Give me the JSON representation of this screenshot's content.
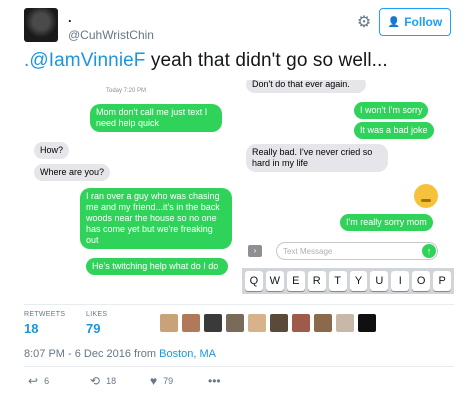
{
  "user": {
    "display_name": ".",
    "handle": "@CuhWristChin",
    "avatar": "profile-photo"
  },
  "header": {
    "settings_icon": "gear-icon",
    "follow_label": "Follow",
    "follow_icon": "add-user-icon"
  },
  "tweet": {
    "mention": ".@IamVinnieF",
    "text": " yeah that didn't go so well..."
  },
  "media": {
    "left": {
      "timestamp": "Today 7:20 PM",
      "messages": [
        {
          "from": "me",
          "text": "Mom don't call me just text I need help quick"
        },
        {
          "from": "them",
          "text": "How?"
        },
        {
          "from": "them",
          "text": "Where are you?"
        },
        {
          "from": "me",
          "text": "I ran over a guy who was chasing me and my friend...it's in the back woods near the house so no one has come yet but we're freaking out"
        },
        {
          "from": "me",
          "text": "He's twitching help what do I do"
        }
      ]
    },
    "right": {
      "messages": [
        {
          "from": "them",
          "text": "Don't do that ever again."
        },
        {
          "from": "me",
          "text": "I won't I'm sorry"
        },
        {
          "from": "me",
          "text": "It was a bad joke"
        },
        {
          "from": "them",
          "text": "Really bad. I've never cried so hard in my life"
        },
        {
          "from": "me",
          "text": "I'm really sorry mom"
        }
      ],
      "emoji": "disappointed-face",
      "input_placeholder": "Text Message",
      "keyboard": [
        "Q",
        "W",
        "E",
        "R",
        "T",
        "Y",
        "U",
        "I",
        "O",
        "P"
      ]
    }
  },
  "stats": {
    "retweets_label": "RETWEETS",
    "retweets": "18",
    "likes_label": "LIKES",
    "likes": "79"
  },
  "likers": [
    "#c9a27a",
    "#b07a5a",
    "#3a3a3a",
    "#7a6a5a",
    "#d8b28a",
    "#5a4a3a",
    "#a05a4a",
    "#8a6a4a",
    "#c8b8a8",
    "#101010"
  ],
  "meta": {
    "datetime": "8:07 PM - 6 Dec 2016 from ",
    "location": "Boston, MA"
  },
  "actions": {
    "reply_icon": "reply-icon",
    "reply_count": "6",
    "retweet_icon": "retweet-icon",
    "retweet_count": "18",
    "like_icon": "heart-icon",
    "like_count": "79",
    "more_icon": "more-icon"
  },
  "colors": {
    "accent": "#1da1f2",
    "imessage_green": "#2fd35a",
    "bubble_gray": "#e5e5ea"
  }
}
